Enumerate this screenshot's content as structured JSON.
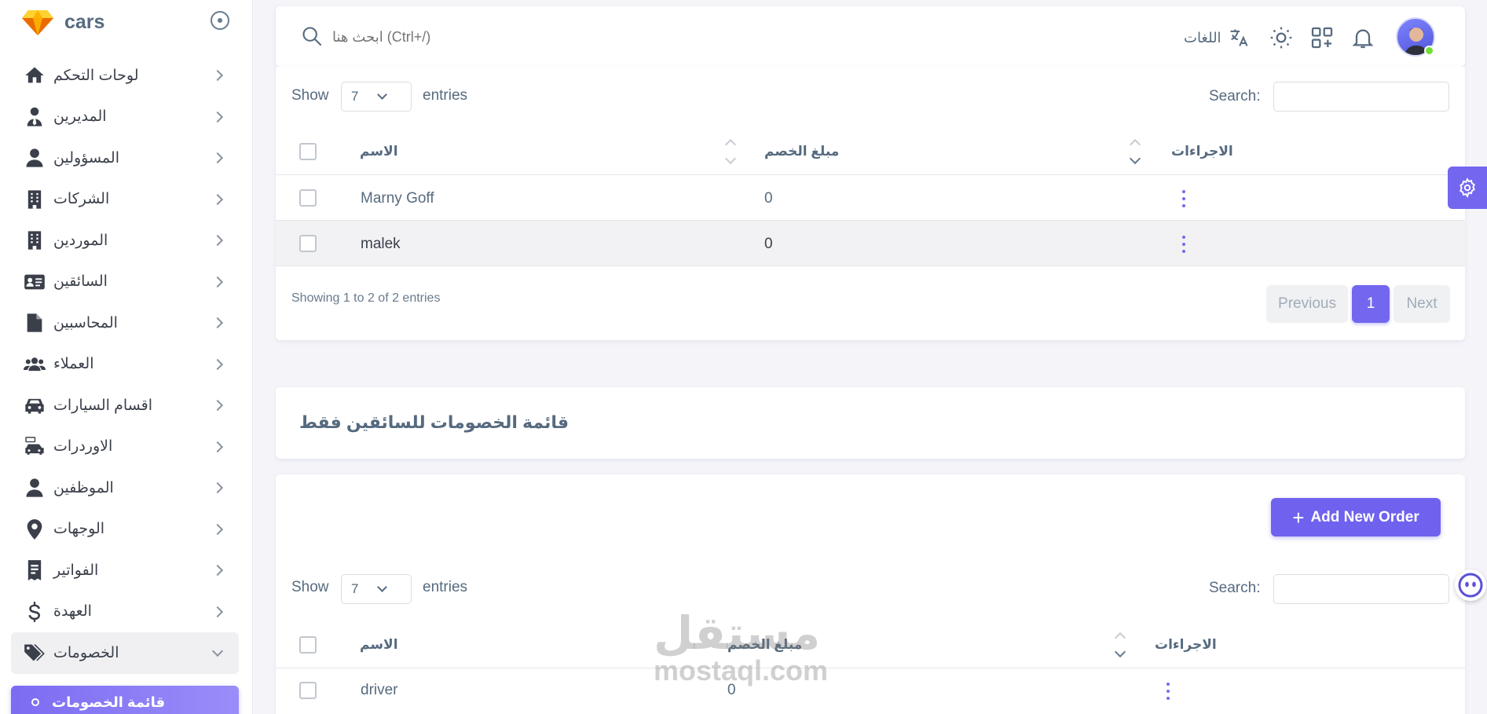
{
  "app": {
    "name": "cars"
  },
  "sidebar": {
    "items": [
      {
        "label": "لوحات التحكم",
        "icon": "home-icon"
      },
      {
        "label": "المديرين",
        "icon": "user-tie-icon"
      },
      {
        "label": "المسؤولين",
        "icon": "user-icon"
      },
      {
        "label": "الشركات",
        "icon": "building-icon"
      },
      {
        "label": "الموردين",
        "icon": "building-icon"
      },
      {
        "label": "السائقين",
        "icon": "id-card-icon"
      },
      {
        "label": "المحاسبين",
        "icon": "file-icon"
      },
      {
        "label": "العملاء",
        "icon": "users-icon"
      },
      {
        "label": "اقسام السيارات",
        "icon": "car-icon"
      },
      {
        "label": "الاوردرات",
        "icon": "rent-car-icon"
      },
      {
        "label": "الموظفين",
        "icon": "user-icon"
      },
      {
        "label": "الوجهات",
        "icon": "map-pin-icon"
      },
      {
        "label": "الفواتير",
        "icon": "receipt-icon"
      },
      {
        "label": "العهدة",
        "icon": "dollar-icon"
      },
      {
        "label": "الخصومات",
        "icon": "tags-icon"
      }
    ],
    "active_sub": "قائمة الخصومات"
  },
  "navbar": {
    "search_placeholder": "ابحث هنا (Ctrl+/)",
    "language_label": "اللغات"
  },
  "table1": {
    "show_label": "Show",
    "entries_value": "7",
    "entries_label": "entries",
    "search_label": "Search:",
    "headers": {
      "name": "الاسم",
      "discount": "مبلغ الخصم",
      "actions": "الاجراءات"
    },
    "rows": [
      {
        "name": "Marny Goff",
        "discount": "0"
      },
      {
        "name": "malek",
        "discount": "0"
      }
    ],
    "info": "Showing 1 to 2 of 2 entries",
    "pagination": {
      "previous": "Previous",
      "page": "1",
      "next": "Next"
    }
  },
  "section2": {
    "title": "قائمة الخصومات للسائقين فقط"
  },
  "table2": {
    "add_button": "Add New Order",
    "show_label": "Show",
    "entries_value": "7",
    "entries_label": "entries",
    "search_label": "Search:",
    "headers": {
      "name": "الاسم",
      "discount": "مبلغ الخصم",
      "actions": "الاجراءات"
    },
    "rows": [
      {
        "name": "driver",
        "discount": "0"
      }
    ]
  },
  "watermark": {
    "line1": "مستقل",
    "line2": "mostaql.com"
  },
  "colors": {
    "primary": "#7367f0",
    "text": "#566a7f",
    "online": "#71dd37"
  }
}
